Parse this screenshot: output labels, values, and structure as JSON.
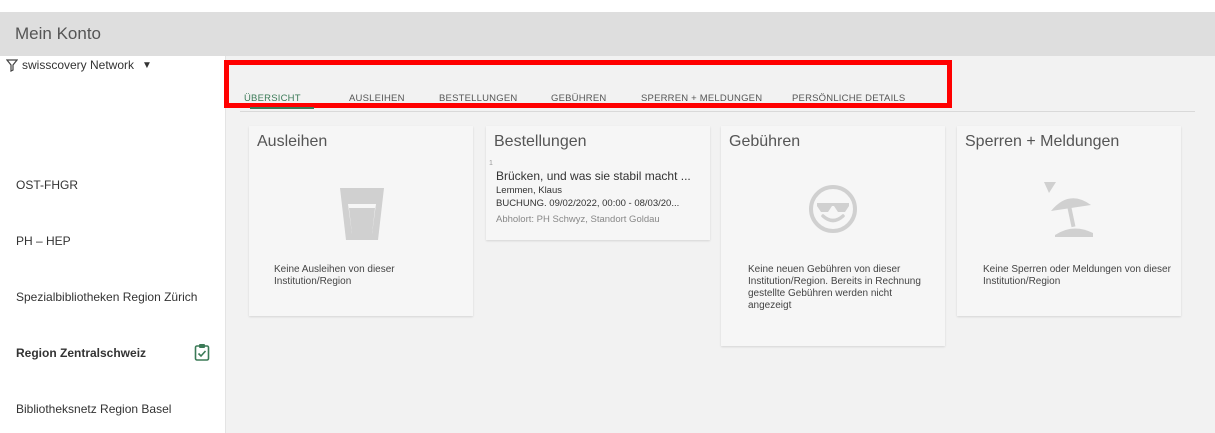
{
  "header": {
    "title": "Mein Konto"
  },
  "sidebar": {
    "network": "swisscovery Network",
    "items": [
      {
        "label": "OST-FHGR"
      },
      {
        "label": "PH – HEP"
      },
      {
        "label": "Spezialbibliotheken Region Zürich"
      },
      {
        "label": "Region Zentralschweiz",
        "active": true
      },
      {
        "label": "Bibliotheksnetz Region Basel"
      }
    ]
  },
  "tabs": [
    {
      "label": "ÜBERSICHT",
      "active": true
    },
    {
      "label": "AUSLEIHEN"
    },
    {
      "label": "BESTELLUNGEN"
    },
    {
      "label": "GEBÜHREN"
    },
    {
      "label": "SPERREN + MELDUNGEN"
    },
    {
      "label": "PERSÖNLICHE DETAILS"
    }
  ],
  "cards": {
    "loans": {
      "title": "Ausleihen",
      "message": "Keine Ausleihen von dieser Institution/Region"
    },
    "requests": {
      "title": "Bestellungen",
      "item": {
        "index": "1",
        "title": "Brücken, und was sie stabil macht ...",
        "author": "Lemmen, Klaus",
        "booking": "BUCHUNG. 09/02/2022, 00:00 - 08/03/20...",
        "pickup": "Abholort: PH Schwyz, Standort Goldau"
      }
    },
    "fees": {
      "title": "Gebühren",
      "message": "Keine neuen Gebühren von dieser Institution/Region. Bereits in Rechnung gestellte Gebühren werden nicht angezeigt"
    },
    "blocks": {
      "title": "Sperren + Meldungen",
      "message": "Keine Sperren oder Meldungen von dieser Institution/Region"
    }
  },
  "colors": {
    "accent": "#3b7a57",
    "highlight_box": "#ff0000",
    "header_bg": "#dedede",
    "main_bg": "#f2f2f2"
  }
}
